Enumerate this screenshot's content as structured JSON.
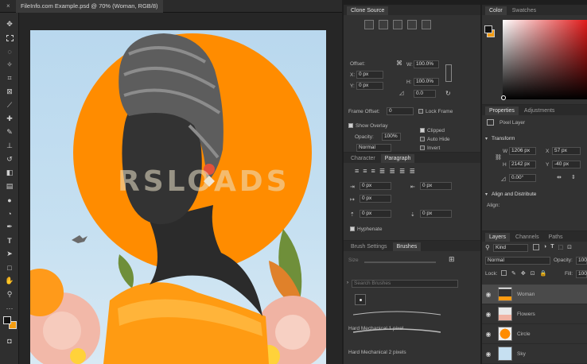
{
  "document": {
    "tab_title": "FileInfo.com Example.psd @ 70% (Woman, RGB/8)",
    "close_glyph": "×"
  },
  "watermark": "RSLOADS",
  "toolbar": {
    "tools": [
      "move-tool-icon",
      "marquee-tool-icon",
      "lasso-tool-icon",
      "magic-wand-icon",
      "crop-tool-icon",
      "frame-tool-icon",
      "eyedropper-icon",
      "healing-brush-icon",
      "brush-tool-icon",
      "clone-stamp-icon",
      "history-brush-icon",
      "eraser-icon",
      "gradient-tool-icon",
      "blur-tool-icon",
      "dodge-tool-icon",
      "pen-tool-icon",
      "type-tool-icon",
      "path-select-icon",
      "shape-tool-icon",
      "hand-tool-icon",
      "zoom-tool-icon",
      "more-tools-icon"
    ]
  },
  "clone_source": {
    "tab": "Clone Source",
    "offset_label": "Offset:",
    "x_label": "X:",
    "x_value": "0 px",
    "y_label": "Y:",
    "y_value": "0 px",
    "w_label": "W:",
    "w_value": "100.0%",
    "h_label": "H:",
    "h_value": "100.0%",
    "angle_value": "0.0",
    "frame_offset_label": "Frame Offset:",
    "frame_offset_value": "0",
    "lock_frame_label": "Lock Frame",
    "show_overlay_label": "Show Overlay",
    "opacity_label": "Opacity:",
    "opacity_value": "100%",
    "blend_value": "Normal",
    "clipped_label": "Clipped",
    "autohide_label": "Auto Hide",
    "invert_label": "Invert"
  },
  "character": {
    "tabs": [
      "Character",
      "Paragraph"
    ],
    "indent_left": "0 px",
    "indent_right": "0 px",
    "indent_first": "0 px",
    "space_before": "0 px",
    "space_after": "0 px",
    "hyphenate_label": "Hyphenate"
  },
  "brushes": {
    "tabs": [
      "Brush Settings",
      "Brushes"
    ],
    "size_label": "Size",
    "search_placeholder": "Search Brushes",
    "items": [
      "Hard Mechanical 1 pixel",
      "Hard Mechanical 2 pixels"
    ]
  },
  "color": {
    "tabs": [
      "Color",
      "Swatches"
    ],
    "fg": "#111111",
    "bg": "#f39c12"
  },
  "properties": {
    "tabs": [
      "Properties",
      "Adjustments"
    ],
    "kind_label": "Pixel Layer",
    "transform_label": "Transform",
    "w_label": "W",
    "w_value": "1206 px",
    "h_label": "H",
    "h_value": "2142 px",
    "x_label": "X",
    "x_value": "57 px",
    "y_label": "Y",
    "y_value": "-40 px",
    "angle_value": "0.00°",
    "align_label": "Align and Distribute",
    "align_sub": "Align:"
  },
  "layers": {
    "tabs": [
      "Layers",
      "Channels",
      "Paths"
    ],
    "kind_value": "Kind",
    "blend_value": "Normal",
    "opacity_label": "Opacity:",
    "opacity_value": "100",
    "lock_label": "Lock:",
    "fill_label": "Fill:",
    "fill_value": "100",
    "items": [
      {
        "name": "Woman",
        "selected": true
      },
      {
        "name": "Flowers",
        "selected": false
      },
      {
        "name": "Circle",
        "selected": false
      },
      {
        "name": "Sky",
        "selected": false
      }
    ]
  }
}
